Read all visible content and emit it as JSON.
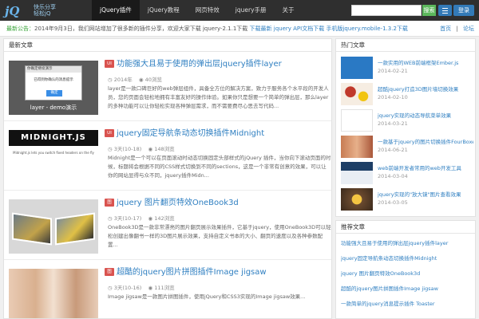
{
  "header": {
    "logo_text": "jQ酷",
    "logo_tagline_1": "快乐分享",
    "logo_tagline_2": "轻松jQ",
    "nav": [
      {
        "label": "jQuery插件",
        "active": true
      },
      {
        "label": "jQuery教程",
        "active": false
      },
      {
        "label": "网页特效",
        "active": false
      },
      {
        "label": "jquery手册",
        "active": false
      },
      {
        "label": "关于",
        "active": false
      }
    ],
    "search_placeholder": "",
    "search_label": "搜索",
    "login_label": "登录"
  },
  "ticker": {
    "prefix": "最新公告：",
    "text": "2014年9月3日，我们网站增加了很多新的插件分享，欢迎大家下载 jquery-2.1.1下载",
    "mid": "  下载最新 jquery API文档下载 手机版jquery.mobile-1.3.2下载",
    "right_1": "首页",
    "right_2": "论坛"
  },
  "main": {
    "panel_title": "最新文章",
    "articles": [
      {
        "badge": "UI",
        "title": "功能强大且易于使用的弹出层jquery插件layer",
        "meta_date": "2014年",
        "meta_views": "40浏览",
        "desc": "layer是一款口碑巨好的web弹层组件，具备全方位的解决方案，致力于服务各个水平段的开发人员，您的页面会轻松地拥有丰富友好的操作体验。如果你只是想要一个简单的弹出层，那么layer的多种功能可以让你轻松实现各种弹层需求，而不需要费尽心思去写代码..."
      },
      {
        "badge": "UI",
        "title": "jquery固定导航条动态切换插件Midnight",
        "meta_date": "3天(10-18)",
        "meta_views": "148浏览",
        "desc": "Midnight是一个可以在页面滚动时动态切换固定头部样式的jQuery 插件，当你向下滚动页面的时候，标题将会根据不同的CSS样式切换到不同的sections，这是一个非常有创意的效果，可以让你的网站显得与众不同，jquery插件Midn..."
      },
      {
        "badge": "图",
        "title": "jquery 图片翻页特效OneBook3d",
        "meta_date": "3天(10-17)",
        "meta_views": "142浏览",
        "desc": "OneBook3D是一款非常漂亮的图片翻页展示效果插件，它基于jquery，使用OneBook3D可以轻松创建出像翻书一样的3D图片展示效果，支持自定义书本的大小、翻页的速度以及各种参数配置..."
      },
      {
        "badge": "图",
        "title": "超酷的jquery图片拼图插件Image jigsaw",
        "meta_date": "3天(10-16)",
        "meta_views": "111浏览",
        "desc": "Image jigsaw是一款图片拼图插件，使用jQuery和CSS3实现的Image jigsaw效果..."
      }
    ]
  },
  "hot": {
    "title": "热门文章",
    "items": [
      {
        "title": "一款实用的WEB前端框架Ember.js",
        "date": "2014-02-21"
      },
      {
        "title": "超酷jquery打造3D图片墙切换效果",
        "date": "2014-02-10"
      },
      {
        "title": "jquery实现的动态导航菜单效果",
        "date": "2014-03-21"
      },
      {
        "title": "一款基于jquery的图片切换插件FourBoxes",
        "date": "2014-06-21"
      },
      {
        "title": "web前端开发者常用的web开发工具",
        "date": "2014-03-04"
      },
      {
        "title": "jquery实现的\"放大镜\"图片查看效果",
        "date": "2014-03-05"
      }
    ]
  },
  "recommend": {
    "title": "推荐文章",
    "items": [
      "功能强大且易于使用的弹出层jquery插件layer",
      "jquery固定导航条动态切换插件Midnight",
      "jquery 图片翻页特效OneBook3d",
      "超酷的jquery图片拼图插件Image jigsaw",
      "一款简单的jquery消息提示插件 Toaster"
    ]
  },
  "thumbs": {
    "layer_caption": "layer - demo演示",
    "layer_dialog_title": "你确定继续演示",
    "layer_dialog_text": "已得到你确认的消息提示",
    "layer_dialog_btn": "确定",
    "midnight_logo": "MIDNIGHT.JS",
    "midnight_sub": "Midnight.js lets you switch fixed headers on the fly"
  },
  "colors": {
    "header_bg": "#2f2f2f",
    "link": "#2f7fc1",
    "badge": "#d9534f",
    "accent_green": "#5cb85c",
    "accent_blue": "#337ab7"
  }
}
